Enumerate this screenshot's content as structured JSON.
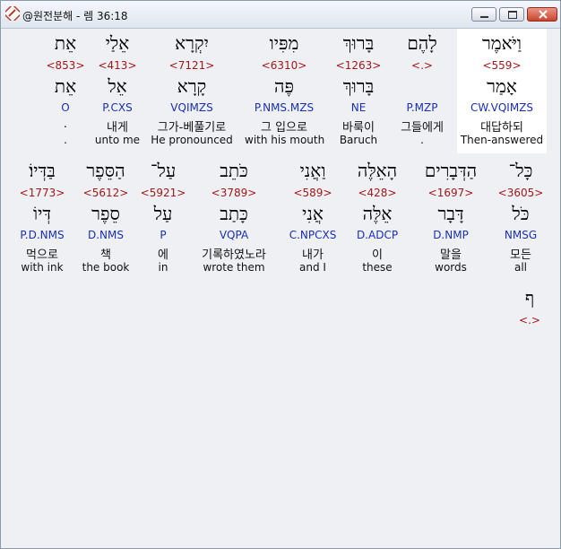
{
  "window": {
    "title": "@원전분해 - 렘 36:18"
  },
  "rows": [
    {
      "words": [
        {
          "heb": "וַיֹּאמֶר",
          "strong": "<559>",
          "lemma": "אָמַר",
          "parse": "CW.VQIMZS",
          "kor": "대답하되",
          "eng": "Then-answered"
        },
        {
          "heb": "לָהֶם",
          "strong": "<.>",
          "lemma": "",
          "parse": "P.MZP",
          "kor": "그들에게",
          "eng": "."
        },
        {
          "heb": "בָּרוּךְ",
          "strong": "<1263>",
          "lemma": "בָּרוּךְ",
          "parse": "NE",
          "kor": "바룩이",
          "eng": "Baruch"
        },
        {
          "heb": "מִפִּיו",
          "strong": "<6310>",
          "lemma": "פֶּה",
          "parse": "P.NMS.MZS",
          "kor": "그 입으로",
          "eng": "with his mouth"
        },
        {
          "heb": "יִקְרָא",
          "strong": "<7121>",
          "lemma": "קָרָא",
          "parse": "VQIMZS",
          "kor": "그가-베풀기로",
          "eng": "He pronounced"
        },
        {
          "heb": "אֵלַי",
          "strong": "<413>",
          "lemma": "אֵל",
          "parse": "P.CXS",
          "kor": "내게",
          "eng": "unto me"
        },
        {
          "heb": "אֵת",
          "strong": "<853>",
          "lemma": "אֵת",
          "parse": "O",
          "kor": ".",
          "eng": "."
        }
      ]
    },
    {
      "words": [
        {
          "heb": "כָּל־",
          "strong": "<3605>",
          "lemma": "כֹּל",
          "parse": "NMSG",
          "kor": "모든",
          "eng": "all"
        },
        {
          "heb": "הַדְּבָרִים",
          "strong": "<1697>",
          "lemma": "דָּבָר",
          "parse": "D.NMP",
          "kor": "말을",
          "eng": "words"
        },
        {
          "heb": "הָאֵלֶּה",
          "strong": "<428>",
          "lemma": "אֵלֶּה",
          "parse": "D.ADCP",
          "kor": "이",
          "eng": "these"
        },
        {
          "heb": "וַאֲנִי",
          "strong": "<589>",
          "lemma": "אֲנִי",
          "parse": "C.NPCXS",
          "kor": "내가",
          "eng": "and I"
        },
        {
          "heb": "כֹּתֵב",
          "strong": "<3789>",
          "lemma": "כָּתַב",
          "parse": "VQPA",
          "kor": "기록하였노라",
          "eng": "wrote them"
        },
        {
          "heb": "עַל־",
          "strong": "<5921>",
          "lemma": "עַל",
          "parse": "P",
          "kor": "에",
          "eng": "in"
        },
        {
          "heb": "הַסֵּפֶר",
          "strong": "<5612>",
          "lemma": "סֵפֶר",
          "parse": "D.NMS",
          "kor": "책",
          "eng": "the book"
        },
        {
          "heb": "בַּדְּיוֹ׃",
          "strong": "<1773>",
          "lemma": "דְּיוֹ",
          "parse": "P.D.NMS",
          "kor": "먹으로",
          "eng": "with ink"
        }
      ]
    },
    {
      "words": [
        {
          "heb": "ף",
          "strong": "<.>",
          "lemma": "",
          "parse": "",
          "kor": "",
          "eng": ""
        }
      ]
    }
  ]
}
